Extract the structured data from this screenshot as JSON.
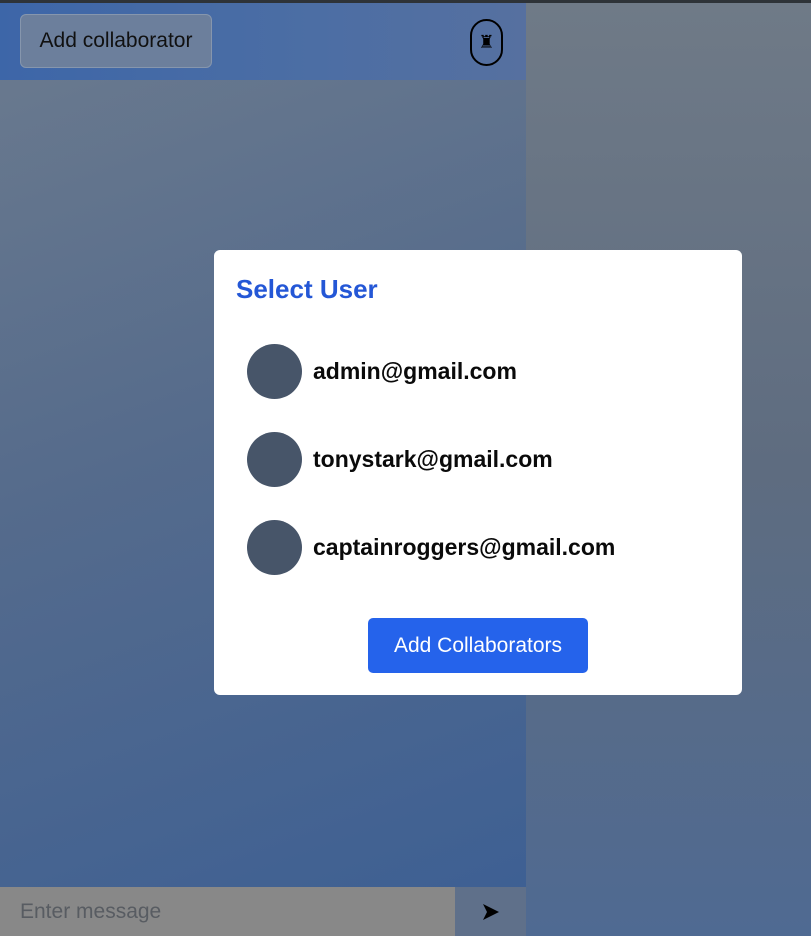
{
  "header": {
    "add_collaborator_label": "Add collaborator",
    "icon": "rook-icon"
  },
  "modal": {
    "title": "Select User",
    "users": [
      {
        "email": "admin@gmail.com"
      },
      {
        "email": "tonystark@gmail.com"
      },
      {
        "email": "captainroggers@gmail.com"
      }
    ],
    "submit_label": "Add Collaborators"
  },
  "composer": {
    "placeholder": "Enter message",
    "value": "",
    "send_icon": "send-icon"
  },
  "colors": {
    "accent": "#2563eb",
    "title": "#2457d6",
    "avatar": "#475569"
  }
}
